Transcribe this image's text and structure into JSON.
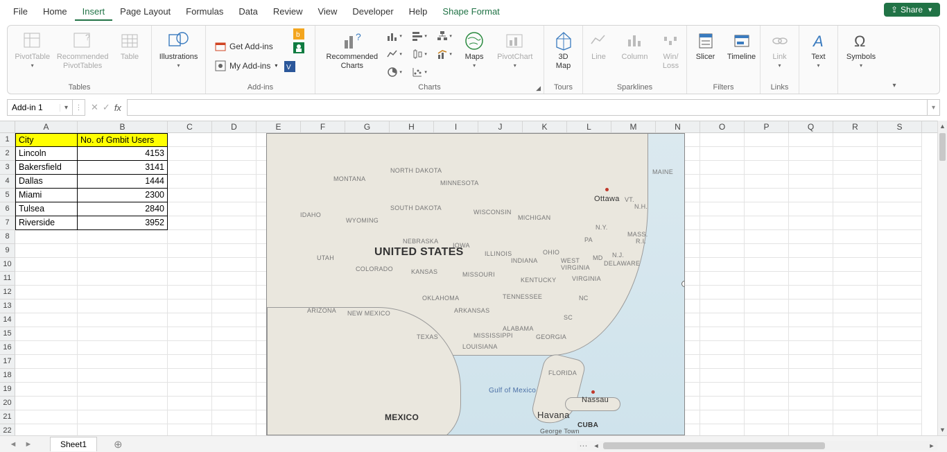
{
  "menu": {
    "items": [
      "File",
      "Home",
      "Insert",
      "Page Layout",
      "Formulas",
      "Data",
      "Review",
      "View",
      "Developer",
      "Help",
      "Shape Format"
    ],
    "active": "Insert",
    "special": "Shape Format"
  },
  "share": {
    "label": "Share"
  },
  "ribbon": {
    "groups": {
      "tables": {
        "label": "Tables",
        "pivot": "PivotTable",
        "recommended": "Recommended\nPivotTables",
        "table": "Table"
      },
      "illustrations": {
        "label": "Illustrations",
        "btn": "Illustrations"
      },
      "addins": {
        "label": "Add-ins",
        "get": "Get Add-ins",
        "my": "My Add-ins"
      },
      "charts": {
        "label": "Charts",
        "recommended": "Recommended\nCharts",
        "maps": "Maps",
        "pivotchart": "PivotChart"
      },
      "tours": {
        "label": "Tours",
        "map3d": "3D\nMap"
      },
      "sparklines": {
        "label": "Sparklines",
        "line": "Line",
        "column": "Column",
        "winloss": "Win/\nLoss"
      },
      "filters": {
        "label": "Filters",
        "slicer": "Slicer",
        "timeline": "Timeline"
      },
      "links": {
        "label": "Links",
        "link": "Link"
      },
      "text": {
        "label": "Text",
        "btn": "Text"
      },
      "symbols": {
        "label": "Symbols",
        "btn": "Symbols"
      }
    }
  },
  "namebox": {
    "value": "Add-in 1"
  },
  "columns": [
    "A",
    "B",
    "C",
    "D",
    "E",
    "F",
    "G",
    "H",
    "I",
    "J",
    "K",
    "L",
    "M",
    "N",
    "O",
    "P",
    "Q",
    "R",
    "S"
  ],
  "rows": [
    1,
    2,
    3,
    4,
    5,
    6,
    7,
    8,
    9,
    10,
    11,
    12,
    13,
    14,
    15,
    16,
    17,
    18,
    19,
    20,
    21,
    22
  ],
  "data": {
    "headers": {
      "a": "City",
      "b": "No. of Gmbit Users"
    },
    "rows": [
      {
        "a": "Lincoln",
        "b": "4153"
      },
      {
        "a": "Bakersfield",
        "b": "3141"
      },
      {
        "a": "Dallas",
        "b": "1444"
      },
      {
        "a": "Miami",
        "b": "2300"
      },
      {
        "a": "Tulsea",
        "b": "2840"
      },
      {
        "a": "Riverside",
        "b": "3952"
      }
    ]
  },
  "map": {
    "country": "UNITED STATES",
    "mexico": "MEXICO",
    "cuba": "CUBA",
    "gulf": "Gulf of Mexico",
    "ottawa": "Ottawa",
    "nassau": "Nassau",
    "havana": "Havana",
    "georgetown": "George Town",
    "states": [
      "MONTANA",
      "NORTH DAKOTA",
      "MINNESOTA",
      "SOUTH DAKOTA",
      "WISCONSIN",
      "MICHIGAN",
      "IDAHO",
      "WYOMING",
      "IOWA",
      "NEBRASKA",
      "ILLINOIS",
      "OHIO",
      "INDIANA",
      "UTAH",
      "COLORADO",
      "KANSAS",
      "MISSOURI",
      "KENTUCKY",
      "VIRGINIA",
      "WEST\nVIRGINIA",
      "ARIZONA",
      "NEW MEXICO",
      "OKLAHOMA",
      "ARKANSAS",
      "TENNESSEE",
      "TEXAS",
      "MISSISSIPPI",
      "LOUISIANA",
      "ALABAMA",
      "GEORGIA",
      "FLORIDA",
      "MAINE",
      "N.H.",
      "VT.",
      "N.Y.",
      "PA",
      "MASS.",
      "R.I.",
      "N.J.",
      "DELAWARE",
      "MD",
      "NC",
      "SC"
    ]
  },
  "sheet": {
    "name": "Sheet1"
  }
}
